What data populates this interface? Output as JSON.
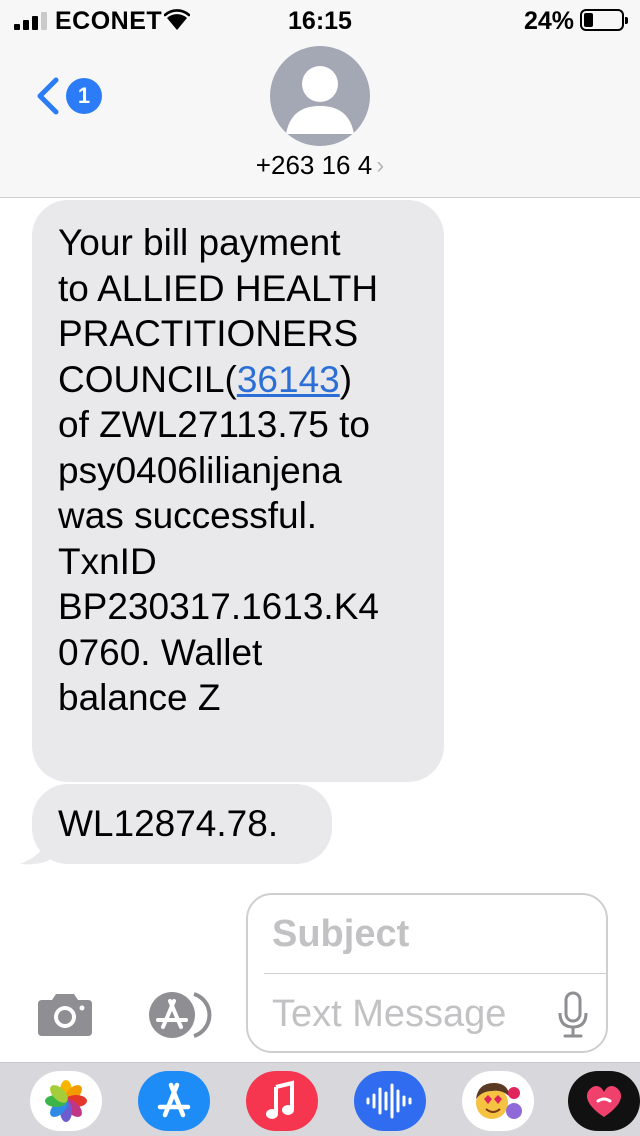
{
  "status_bar": {
    "carrier": "ECONET",
    "time": "16:15",
    "battery_percent": "24%",
    "battery_level": 0.24,
    "signal_bars": 3
  },
  "header": {
    "back_badge": "1",
    "contact": "+263 16 4",
    "contact_chevron": "›",
    "avatar_icon": "person-silhouette-icon"
  },
  "messages": [
    {
      "before_link": "Your bill payment\nto ALLIED HEALTH\nPRACTITIONERS\nCOUNCIL(",
      "link": "36143",
      "after_link": ")\nof ZWL27113.75 to\npsy0406lilianjena\nwas successful.\nTxnID\nBP230317.1613.K4\n0760. Wallet\nbalance Z"
    },
    {
      "text": "WL12874.78."
    }
  ],
  "compose": {
    "subject_placeholder": "Subject",
    "message_placeholder": "Text Message"
  },
  "drawer": {
    "apps": [
      "photos-icon",
      "app-store-icon",
      "music-icon",
      "audio-message-icon",
      "memoji-stickers-icon",
      "digital-touch-icon"
    ]
  },
  "colors": {
    "accent": "#2b7cf6",
    "bubble_gray": "#e9e9eb",
    "header_bg": "#f7f7f7",
    "drawer_bg": "#d8d8dc"
  }
}
